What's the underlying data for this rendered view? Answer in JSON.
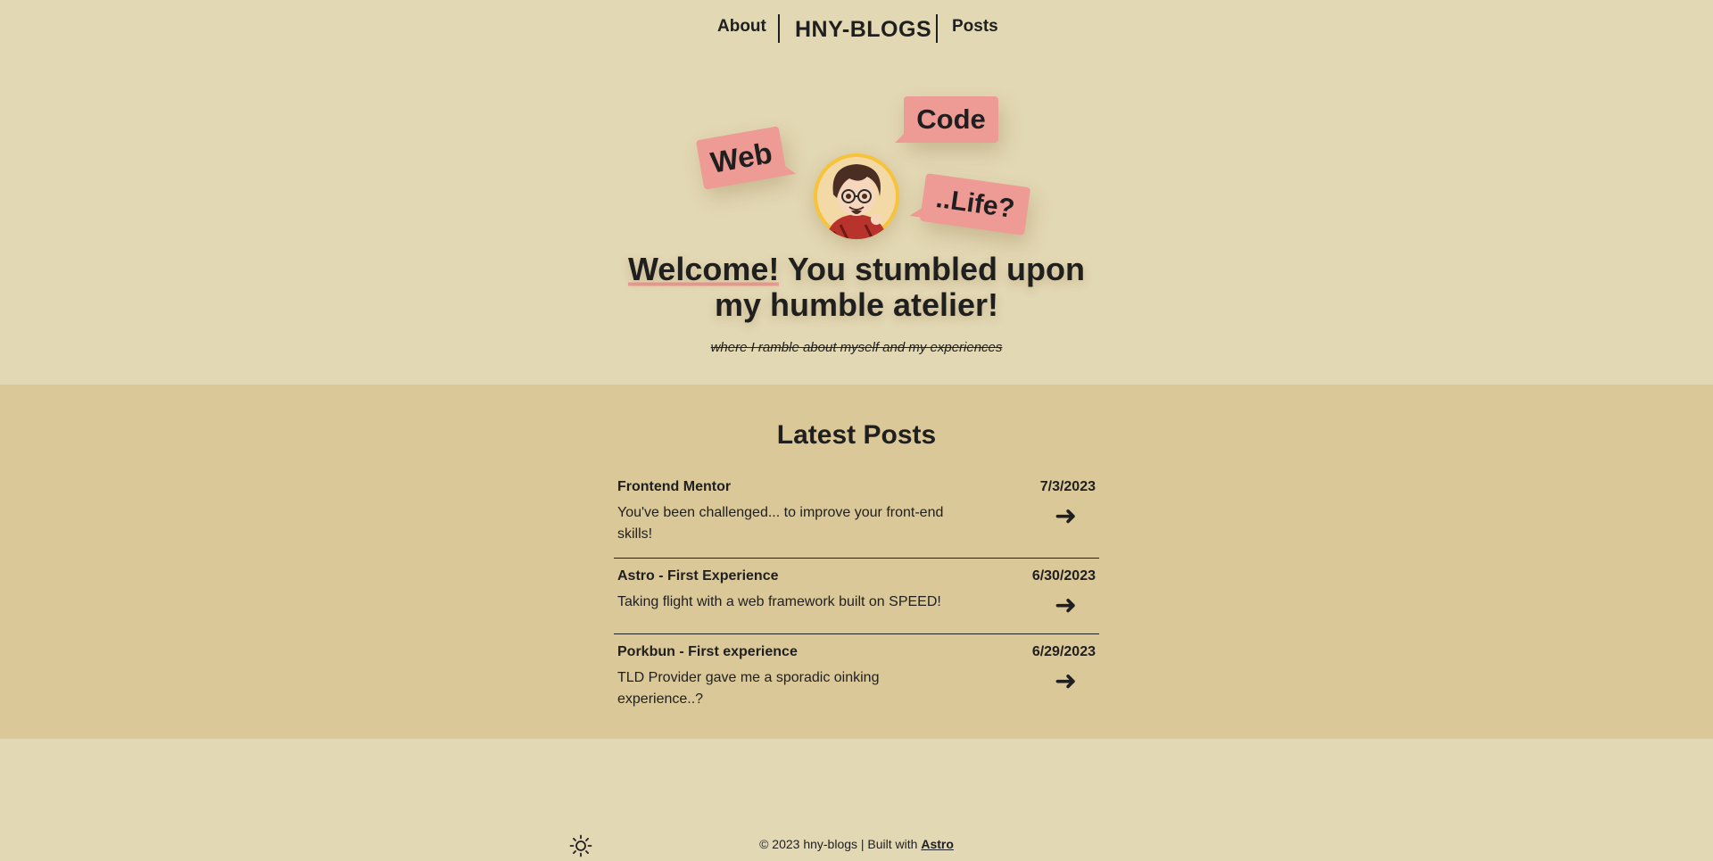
{
  "nav": {
    "about": "About",
    "brand": "HNY-BLOGS",
    "posts": "Posts"
  },
  "hero": {
    "bubbles": {
      "web": "Web",
      "code": "Code",
      "life": "..Life?"
    },
    "avatar_icon": "chibi-avatar",
    "welcome_strong": "Welcome!",
    "welcome_rest": " You stumbled upon my humble atelier!",
    "tagline": "where I ramble about myself and my experiences"
  },
  "latest": {
    "title": "Latest Posts",
    "posts": [
      {
        "title": "Frontend Mentor",
        "date": "7/3/2023",
        "desc": "You've been challenged... to improve your front-end skills!",
        "arrow": "➜"
      },
      {
        "title": "Astro - First Experience",
        "date": "6/30/2023",
        "desc": "Taking flight with a web framework built on SPEED!",
        "arrow": "➜"
      },
      {
        "title": "Porkbun - First experience",
        "date": "6/29/2023",
        "desc": "TLD Provider gave me a sporadic oinking experience..?",
        "arrow": "➜"
      }
    ]
  },
  "footer": {
    "text": "© 2023 hny-blogs | Built with ",
    "link": "Astro",
    "theme_icon": "sun-icon"
  },
  "colors": {
    "background": "#e3d8b4",
    "posts_background": "#dbc898",
    "accent_pink": "#ee9a95",
    "text": "#1f1f1f",
    "avatar_ring": "#f6c33b"
  }
}
